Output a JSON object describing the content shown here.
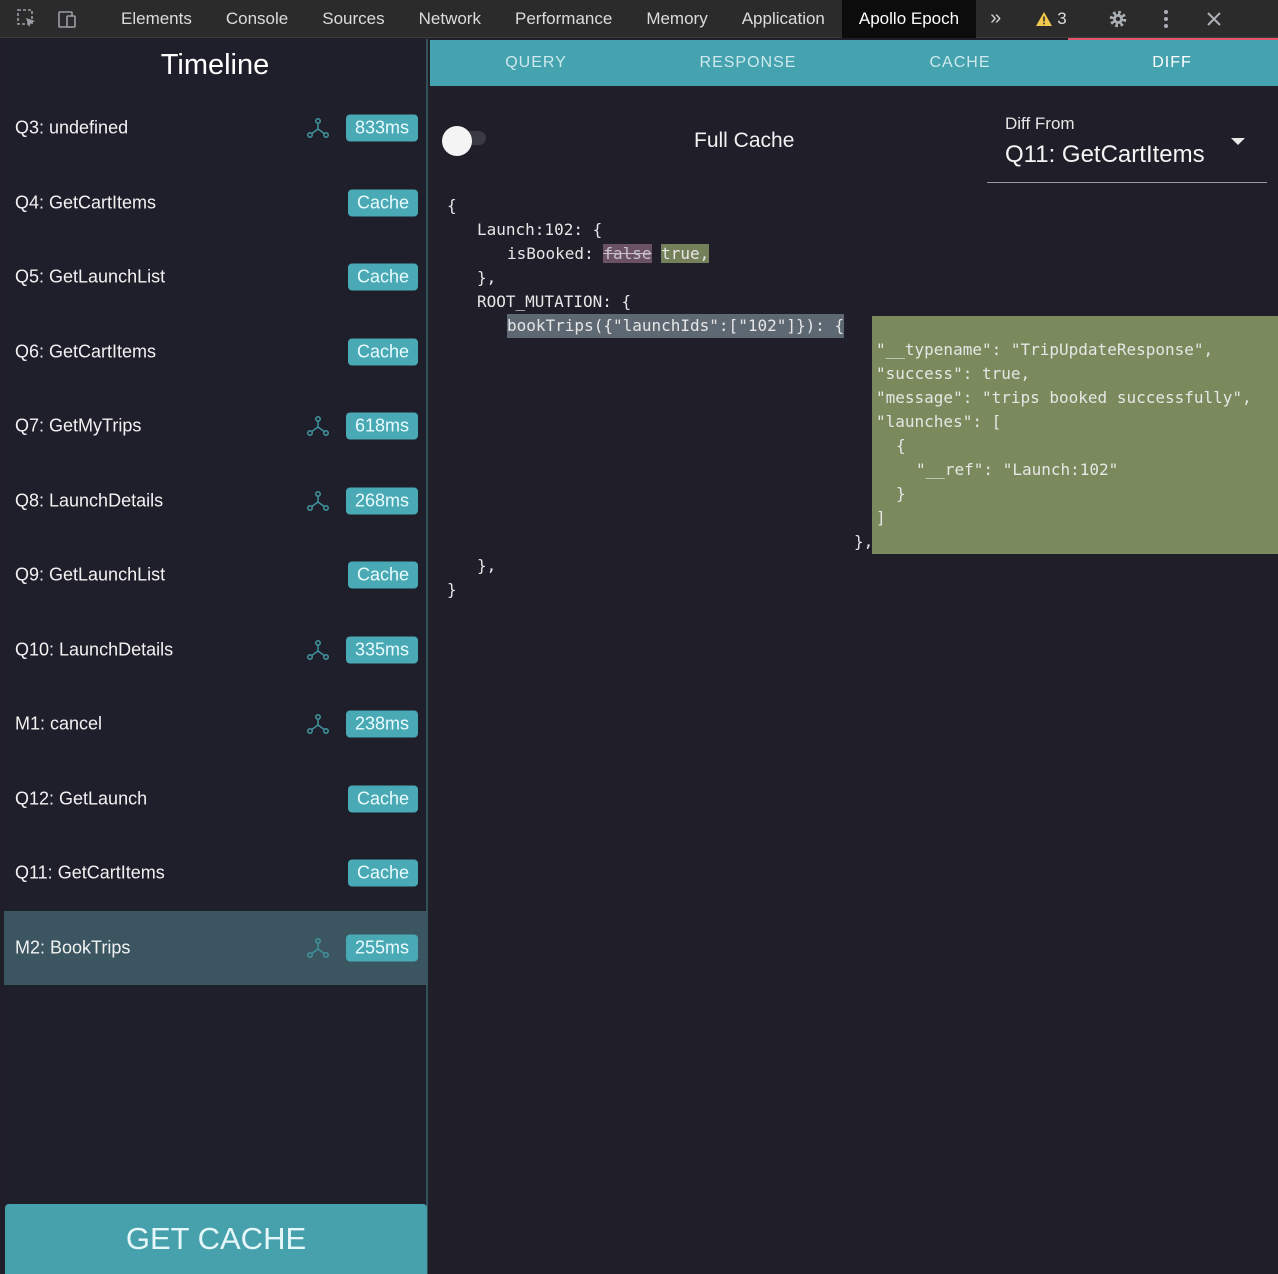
{
  "devtools": {
    "tabs": [
      "Elements",
      "Console",
      "Sources",
      "Network",
      "Performance",
      "Memory",
      "Application",
      "Apollo Epoch"
    ],
    "active_tab": "Apollo Epoch",
    "more": "»",
    "warning_count": "3"
  },
  "sidebar": {
    "title": "Timeline",
    "items": [
      {
        "label": "Q3: undefined",
        "badge": "833ms",
        "network": true
      },
      {
        "label": "Q4: GetCartItems",
        "badge": "Cache",
        "network": false
      },
      {
        "label": "Q5: GetLaunchList",
        "badge": "Cache",
        "network": false
      },
      {
        "label": "Q6: GetCartItems",
        "badge": "Cache",
        "network": false
      },
      {
        "label": "Q7: GetMyTrips",
        "badge": "618ms",
        "network": true
      },
      {
        "label": "Q8: LaunchDetails",
        "badge": "268ms",
        "network": true
      },
      {
        "label": "Q9: GetLaunchList",
        "badge": "Cache",
        "network": false
      },
      {
        "label": "Q10: LaunchDetails",
        "badge": "335ms",
        "network": true
      },
      {
        "label": "M1: cancel",
        "badge": "238ms",
        "network": true
      },
      {
        "label": "Q12: GetLaunch",
        "badge": "Cache",
        "network": false
      },
      {
        "label": "Q11: GetCartItems",
        "badge": "Cache",
        "network": false
      },
      {
        "label": "M2: BookTrips",
        "badge": "255ms",
        "network": true,
        "selected": true
      }
    ],
    "get_cache_label": "GET CACHE"
  },
  "main": {
    "tabs": [
      "QUERY",
      "RESPONSE",
      "CACHE",
      "DIFF"
    ],
    "active_tab": "DIFF",
    "full_cache_label": "Full Cache",
    "diff_from_label": "Diff From",
    "diff_from_value": "Q11: GetCartItems",
    "code": {
      "open_brace": "{",
      "launch_key": "Launch:102: {",
      "is_booked_key": "isBooked: ",
      "removed_value": "false",
      "added_value": "true,",
      "launch_close": "},",
      "root_mutation_key": "ROOT_MUTATION: {",
      "book_trips_key": "bookTrips({\"launchIds\":[\"102\"]}): {",
      "added_lines": [
        "\"__typename\": \"TripUpdateResponse\",",
        "\"success\": true,",
        "\"message\": \"trips booked successfully\",",
        "\"launches\": [",
        "{",
        "\"__ref\": \"Launch:102\"",
        "}",
        "]",
        "},"
      ],
      "root_close": "},",
      "close_brace": "}"
    }
  },
  "colors": {
    "accent_teal": "#45a3b0",
    "badge_teal": "#49a9b5",
    "selected_row": "#3b5661",
    "diff_added": "#7a8a5c",
    "diff_removed": "#6a5163",
    "devtools_accent": "#e3556b"
  }
}
